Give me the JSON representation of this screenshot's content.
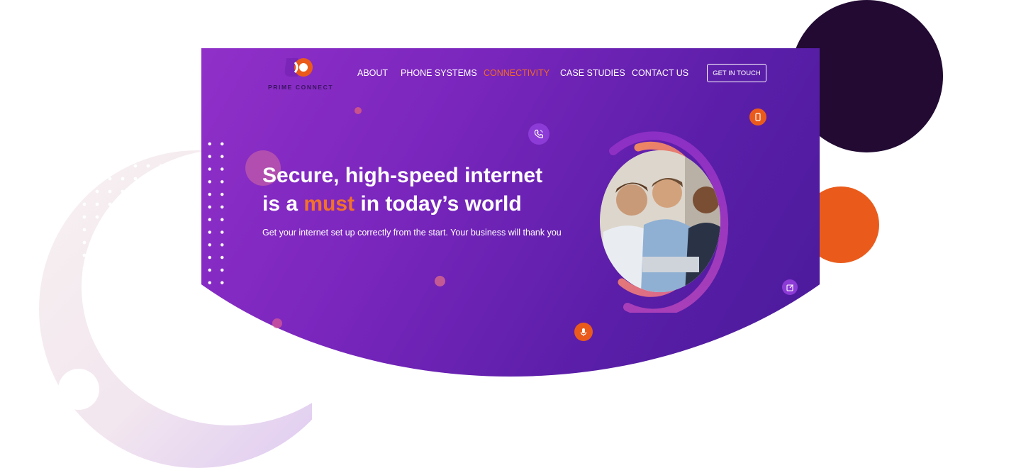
{
  "brand": {
    "name": "PRIME CONNECT"
  },
  "nav": {
    "items": [
      {
        "label": "ABOUT"
      },
      {
        "label": "PHONE SYSTEMS"
      },
      {
        "label": "CONNECTIVITY",
        "active": true
      },
      {
        "label": "CASE STUDIES"
      },
      {
        "label": "CONTACT US"
      }
    ],
    "cta_label": "GET IN TOUCH"
  },
  "hero": {
    "headline_part1": "Secure, high-speed internet",
    "headline_part2_pre": "is a ",
    "headline_accent": "must",
    "headline_part2_post": " in today’s world",
    "subtitle": "Get your internet set up correctly from the start. Your business will thank you"
  },
  "icons": [
    "phone-call-icon",
    "mobile-phone-icon",
    "edit-icon",
    "microphone-icon"
  ],
  "colors": {
    "hero_gradient_start": "#9030c9",
    "hero_gradient_end": "#4a1a9a",
    "accent_orange": "#ea5b1b",
    "nav_active": "#f26a23",
    "dark_circle": "#220a33"
  }
}
